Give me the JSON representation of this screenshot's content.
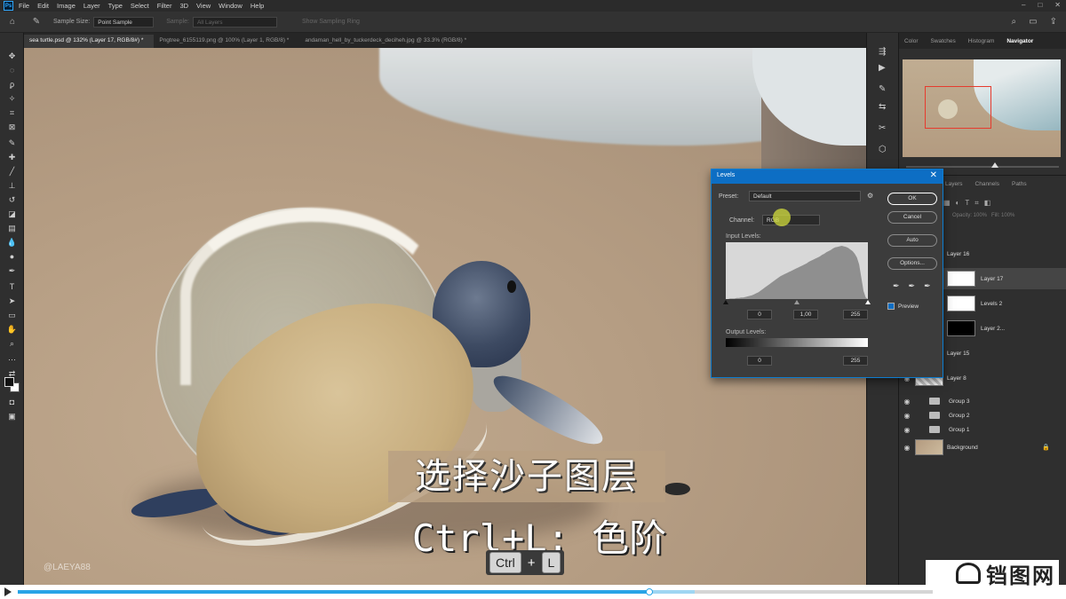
{
  "menu": {
    "logo": "Ps",
    "items": [
      "File",
      "Edit",
      "Image",
      "Layer",
      "Type",
      "Select",
      "Filter",
      "3D",
      "View",
      "Window",
      "Help"
    ]
  },
  "options": {
    "sample_size_label": "Sample Size:",
    "sample_size_value": "Point Sample",
    "sample_label": "Sample:",
    "sample_value": "All Layers",
    "show_ring_label": "Show Sampling Ring"
  },
  "tabs": [
    {
      "label": "sea turtle.psd @ 132% (Layer 17, RGB/8#) *",
      "active": true
    },
    {
      "label": "Pngtree_6155119.png @ 100% (Layer 1, RGB/8) *",
      "active": false
    },
    {
      "label": "andaman_hell_by_tuckerdeck_deciheh.jpg @ 33.3% (RGB/8) *",
      "active": false
    }
  ],
  "subtitles": {
    "line1": "选择沙子图层",
    "line2": "Ctrl+L: 色阶",
    "key1": "Ctrl",
    "key_plus": "+",
    "key2": "L"
  },
  "watermark": "@LAEYA88",
  "navigator": {
    "tabs": [
      "Color",
      "Swatches",
      "Histogram",
      "Navigator"
    ],
    "active_tab": "Navigator",
    "zoom_fraction": 0.58
  },
  "layers": {
    "header_tabs": [
      "Layers",
      "Channels",
      "Paths"
    ],
    "rows": [
      {
        "name": "Layer 16",
        "thumb": "checker",
        "mask": "",
        "selected": false
      },
      {
        "name": "Layer 17",
        "thumb": "checker",
        "mask": "white",
        "selected": true
      },
      {
        "name": "Levels 2",
        "thumb": "checker",
        "mask": "white",
        "selected": false
      },
      {
        "name": "Layer 2...",
        "thumb": "checker",
        "mask": "black",
        "selected": false
      },
      {
        "name": "Layer 15",
        "thumb": "checker",
        "mask": "",
        "selected": false
      },
      {
        "name": "Layer 8",
        "thumb": "checker",
        "mask": "",
        "selected": false
      },
      {
        "name": "Group 3",
        "thumb": "folder",
        "mask": "",
        "selected": false
      },
      {
        "name": "Group 2",
        "thumb": "folder",
        "mask": "",
        "selected": false
      },
      {
        "name": "Group 1",
        "thumb": "folder",
        "mask": "",
        "selected": false
      },
      {
        "name": "Background",
        "thumb": "bg",
        "mask": "",
        "selected": false
      }
    ]
  },
  "levels_dialog": {
    "title": "Levels",
    "preset_label": "Preset:",
    "preset_value": "Default",
    "channel_label": "Channel:",
    "channel_value": "RGB",
    "input_levels_label": "Input Levels:",
    "input_black": "0",
    "input_gamma": "1,00",
    "input_white": "255",
    "output_levels_label": "Output Levels:",
    "output_black": "0",
    "output_white": "255",
    "buttons": {
      "ok": "OK",
      "cancel": "Cancel",
      "auto": "Auto",
      "options": "Options..."
    },
    "preview_label": "Preview",
    "preview_checked": true,
    "histogram_bins": [
      0,
      0,
      1,
      1,
      1,
      2,
      2,
      3,
      3,
      4,
      5,
      6,
      7,
      9,
      11,
      13,
      16,
      19,
      22,
      25,
      28,
      31,
      34,
      37,
      40,
      43,
      45,
      47,
      49,
      51,
      53,
      55,
      57,
      59,
      61,
      63,
      65,
      67,
      70,
      72,
      74,
      76,
      78,
      80,
      83,
      85,
      88,
      90,
      92,
      95,
      97,
      98,
      99,
      100,
      99,
      98,
      96,
      93,
      90,
      85,
      78,
      65,
      40,
      15,
      3,
      0
    ]
  },
  "video": {
    "progress": 0.69,
    "buffered": 0.74,
    "site_logo": "铛图网"
  },
  "colors": {
    "accent_blue": "#0d6ec4",
    "progress_blue": "#29a4e6",
    "nav_highlight": "#e63b2e"
  }
}
